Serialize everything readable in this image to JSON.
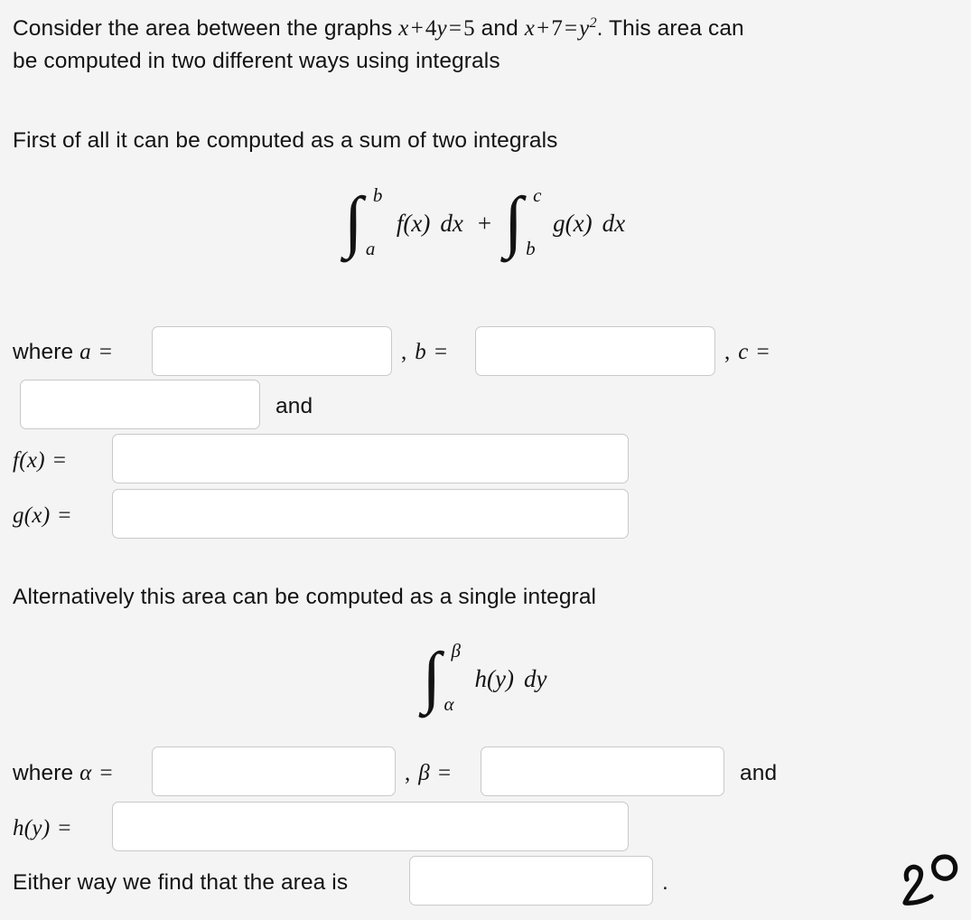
{
  "problem": {
    "statement_line1_pre": "Consider the area between the graphs ",
    "eq1": {
      "x": "x",
      "plus": "+",
      "coef": "4",
      "y": "y",
      "eq": "=",
      "rhs": "5"
    },
    "statement_line1_mid": " and ",
    "eq2": {
      "x": "x",
      "plus": "+",
      "seven": "7",
      "eq": "=",
      "y": "y",
      "exp": "2"
    },
    "statement_line1_post": ". This area can",
    "statement_line2": "be computed in two different ways using integrals",
    "paragraph2": "First of all it can be computed as a sum of two integrals",
    "paragraph3": "Alternatively this area can be computed as a single integral"
  },
  "display_math_1": {
    "integral1": {
      "lower": "a",
      "upper": "b",
      "integrand": "f(x)",
      "differential": "dx"
    },
    "operator": "+",
    "integral2": {
      "lower": "b",
      "upper": "c",
      "integrand": "g(x)",
      "differential": "dx"
    }
  },
  "display_math_2": {
    "integral": {
      "lower": "α",
      "upper": "β",
      "integrand": "h(y)",
      "differential": "dy"
    }
  },
  "answers": {
    "where_label": "where",
    "var_a": "a",
    "var_b": "b",
    "var_c": "c",
    "var_alpha": "α",
    "var_beta": "β",
    "equals": "=",
    "comma": ",",
    "and": "and",
    "label_fx": "f(x)",
    "label_gx": "g(x)",
    "label_hy": "h(y)",
    "either_way": "Either way we find that the area is",
    "period": ".",
    "fields": {
      "a": {
        "value": "",
        "placeholder": ""
      },
      "b": {
        "value": "",
        "placeholder": ""
      },
      "c": {
        "value": "",
        "placeholder": ""
      },
      "fx": {
        "value": "",
        "placeholder": ""
      },
      "gx": {
        "value": "",
        "placeholder": ""
      },
      "alpha": {
        "value": "",
        "placeholder": ""
      },
      "beta": {
        "value": "",
        "placeholder": ""
      },
      "hy": {
        "value": "",
        "placeholder": ""
      },
      "area": {
        "value": "",
        "placeholder": ""
      }
    }
  },
  "annotation": {
    "handwritten_mark": "20"
  },
  "colors": {
    "page_background": "#f4f4f4",
    "text": "#131313",
    "field_background": "#ffffff",
    "field_border": "#c9c9c9",
    "ink": "#0d0d0d"
  }
}
